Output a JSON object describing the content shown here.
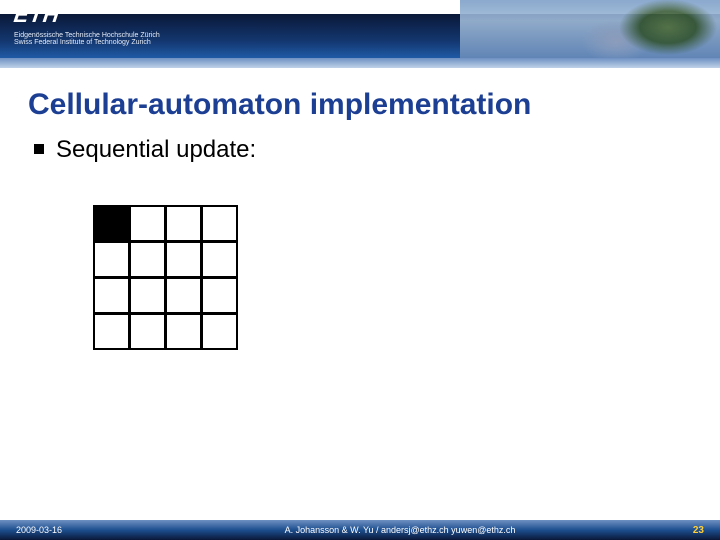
{
  "header": {
    "logo_text": "ETH",
    "logo_sub1": "Eidgenössische Technische Hochschule Zürich",
    "logo_sub2": "Swiss Federal Institute of Technology Zurich"
  },
  "title": "Cellular-automaton implementation",
  "bullet": "Sequential update:",
  "grid": {
    "rows": 4,
    "cols": 4,
    "filled": [
      [
        0,
        0
      ]
    ]
  },
  "footer": {
    "date": "2009-03-16",
    "center": "A. Johansson & W. Yu / andersj@ethz.ch yuwen@ethz.ch",
    "page": "23"
  }
}
